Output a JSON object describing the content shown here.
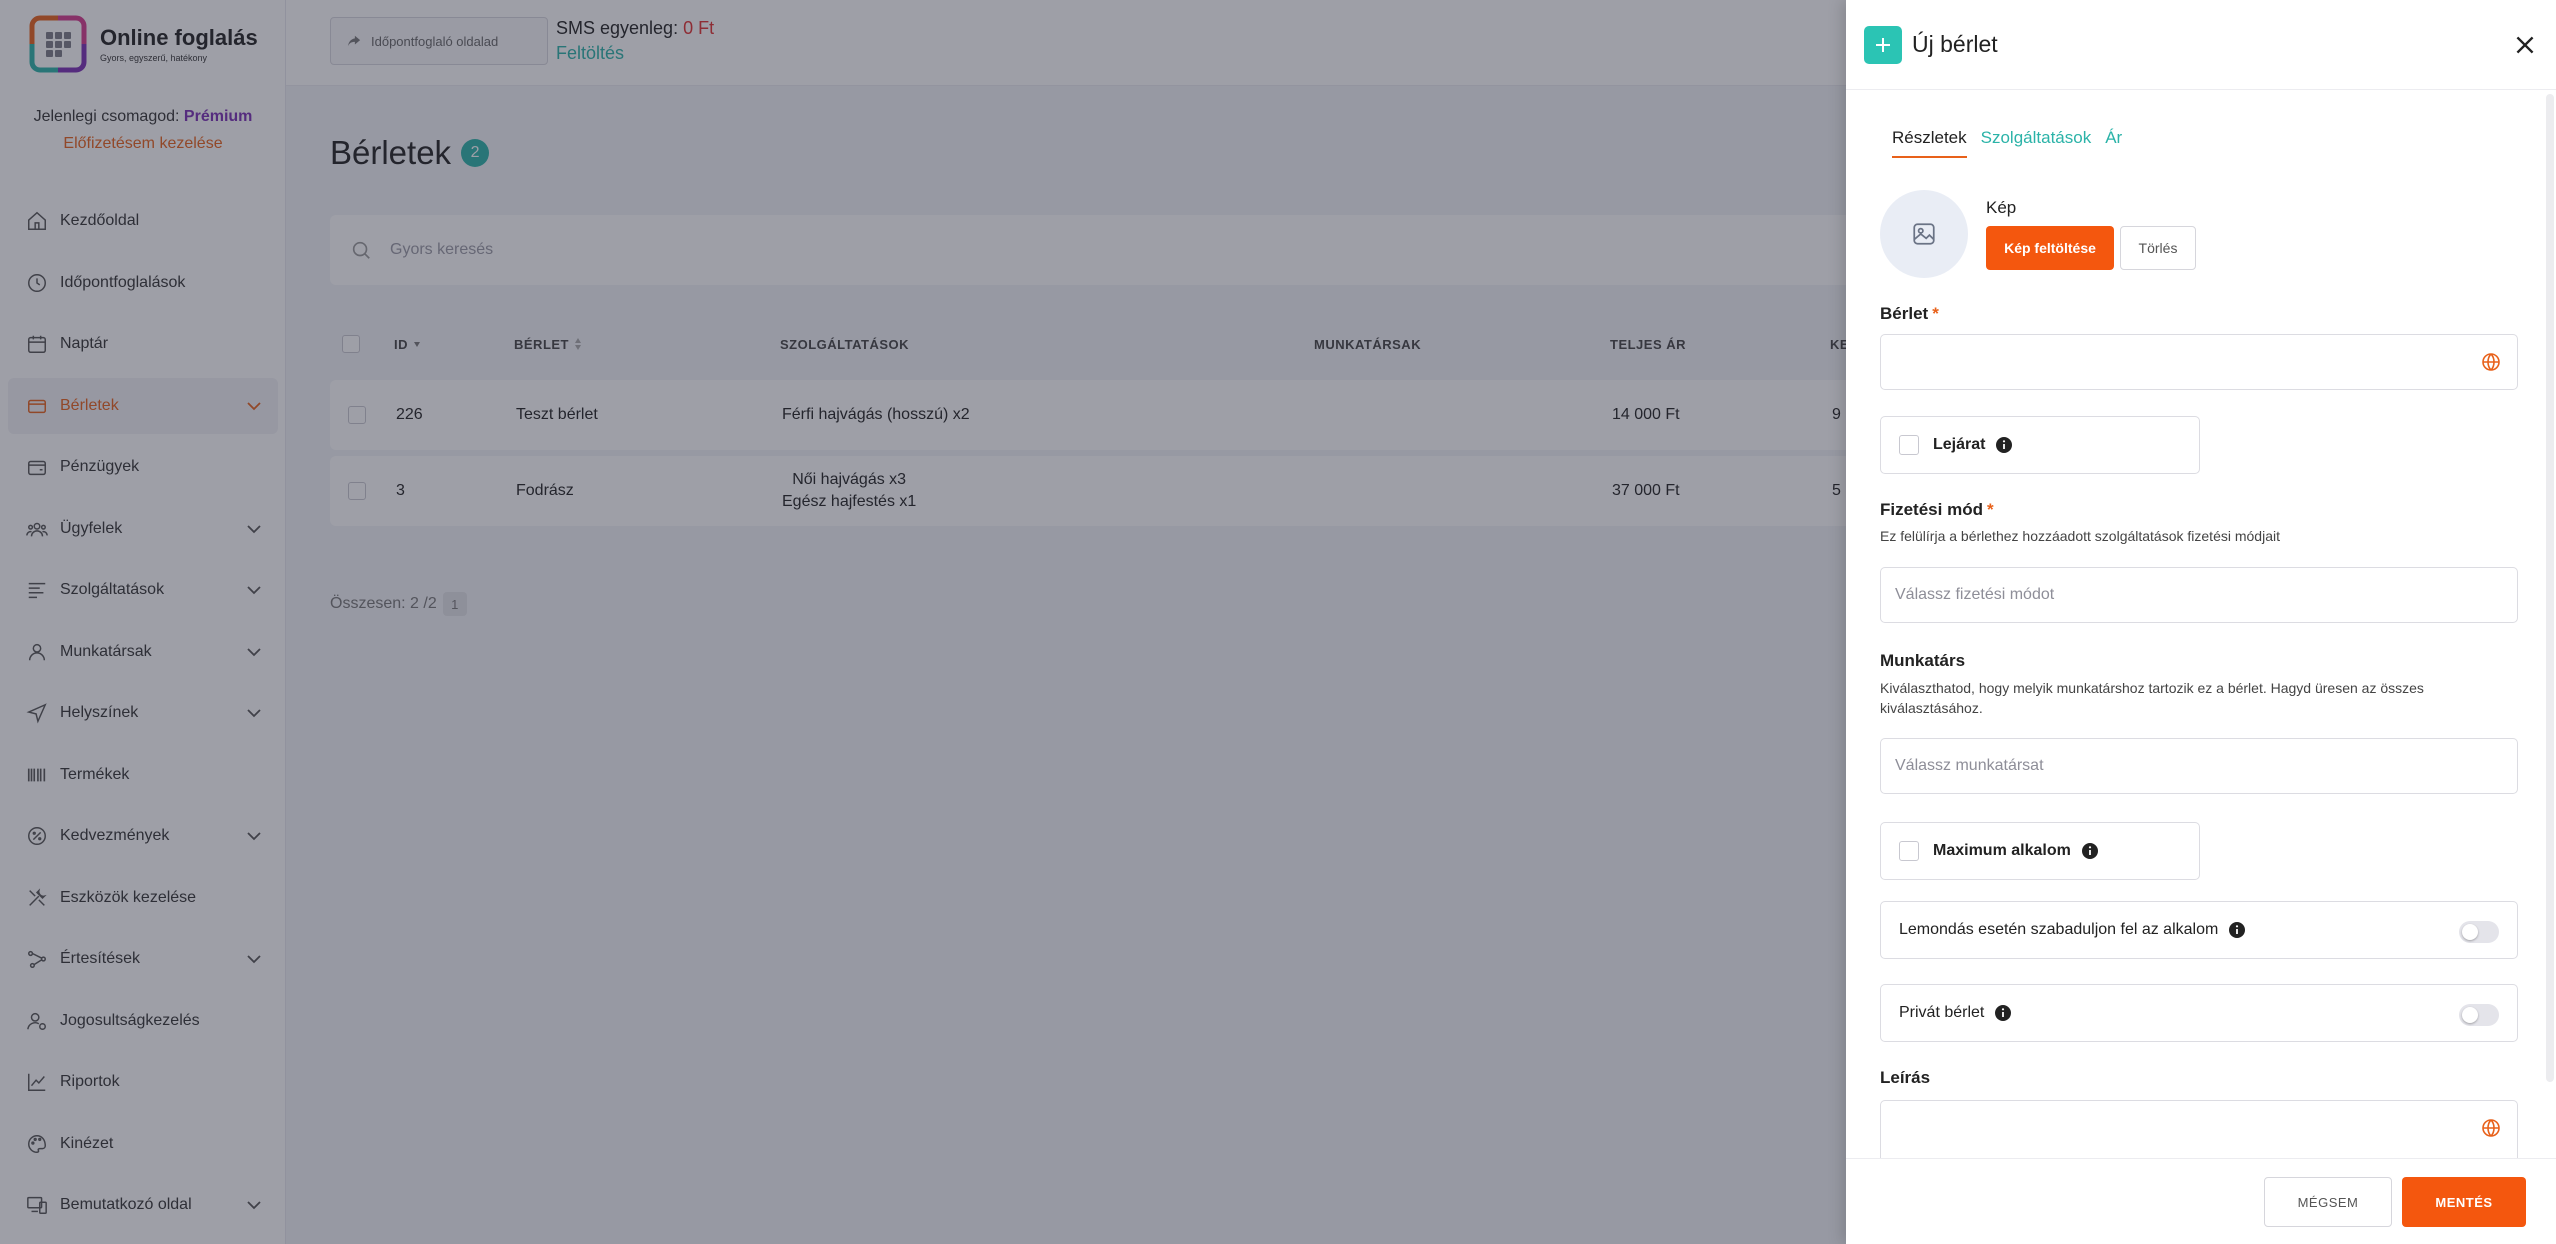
{
  "app": {
    "logo_title": "Online foglalás",
    "logo_subtitle": "Gyors, egyszerű, hatékony",
    "plan_prefix": "Jelenlegi csomagod:",
    "plan_name": "Prémium",
    "plan_manage": "Előfizetésem kezelése",
    "accent_color": "#e8611a",
    "teal_color": "#2bb3a8"
  },
  "topbar": {
    "booking_page_button": "Időpontfoglaló oldalad",
    "sms_label": "SMS egyenleg:",
    "sms_amount": "0 Ft",
    "topup_link": "Feltöltés"
  },
  "sidebar": {
    "items": [
      {
        "label": "Kezdőoldal",
        "icon": "home-icon",
        "expandable": false
      },
      {
        "label": "Időpontfoglalások",
        "icon": "clock-icon",
        "expandable": false
      },
      {
        "label": "Naptár",
        "icon": "calendar-icon",
        "expandable": false
      },
      {
        "label": "Bérletek",
        "icon": "ticket-icon",
        "expandable": true,
        "active": true
      },
      {
        "label": "Pénzügyek",
        "icon": "wallet-icon",
        "expandable": false
      },
      {
        "label": "Ügyfelek",
        "icon": "users-icon",
        "expandable": true
      },
      {
        "label": "Szolgáltatások",
        "icon": "list-icon",
        "expandable": true
      },
      {
        "label": "Munkatársak",
        "icon": "user-icon",
        "expandable": true
      },
      {
        "label": "Helyszínek",
        "icon": "location-icon",
        "expandable": true
      },
      {
        "label": "Termékek",
        "icon": "barcode-icon",
        "expandable": false
      },
      {
        "label": "Kedvezmények",
        "icon": "discount-icon",
        "expandable": true
      },
      {
        "label": "Eszközök kezelése",
        "icon": "tools-icon",
        "expandable": false
      },
      {
        "label": "Értesítések",
        "icon": "share-icon",
        "expandable": true
      },
      {
        "label": "Jogosultságkezelés",
        "icon": "user-cog-icon",
        "expandable": false
      },
      {
        "label": "Riportok",
        "icon": "chart-icon",
        "expandable": false
      },
      {
        "label": "Kinézet",
        "icon": "palette-icon",
        "expandable": false
      },
      {
        "label": "Bemutatkozó oldal",
        "icon": "devices-icon",
        "expandable": true
      }
    ]
  },
  "main": {
    "title": "Bérletek",
    "count": "2",
    "search_placeholder": "Gyors keresés",
    "columns": [
      "ID",
      "BÉRLET",
      "SZOLGÁLTATÁSOK",
      "MUNKATÁRSAK",
      "TELJES ÁR",
      "KE"
    ],
    "rows": [
      {
        "id": "226",
        "name": "Teszt bérlet",
        "services": [
          "Férfi hajvágás (hosszú) x2"
        ],
        "staff": "",
        "price": "14 000 Ft",
        "extra": "9"
      },
      {
        "id": "3",
        "name": "Fodrász",
        "services": [
          "Női hajvágás x3",
          "Egész hajfestés x1"
        ],
        "staff": "",
        "price": "37 000 Ft",
        "extra": "5"
      }
    ],
    "total_label": "Összesen: 2 /2",
    "page": "1"
  },
  "drawer": {
    "title": "Új bérlet",
    "tabs": [
      "Részletek",
      "Szolgáltatások",
      "Ár"
    ],
    "image_label": "Kép",
    "upload_button": "Kép feltöltése",
    "delete_button": "Törlés",
    "name_label": "Bérlet",
    "required_mark": "*",
    "expiry_label": "Lejárat",
    "payment_label": "Fizetési mód",
    "payment_help": "Ez felülírja a bérlethez hozzáadott szolgáltatások fizetési módjait",
    "payment_placeholder": "Válassz fizetési módot",
    "staff_label": "Munkatárs",
    "staff_help": "Kiválaszthatod, hogy melyik munkatárshoz tartozik ez a bérlet. Hagyd üresen az összes kiválasztásához.",
    "staff_placeholder": "Válassz munkatársat",
    "max_label": "Maximum alkalom",
    "cancel_free_label": "Lemondás esetén szabaduljon fel az alkalom",
    "private_label": "Privát bérlet",
    "description_label": "Leírás",
    "cancel_button": "MÉGSEM",
    "save_button": "MENTÉS"
  }
}
